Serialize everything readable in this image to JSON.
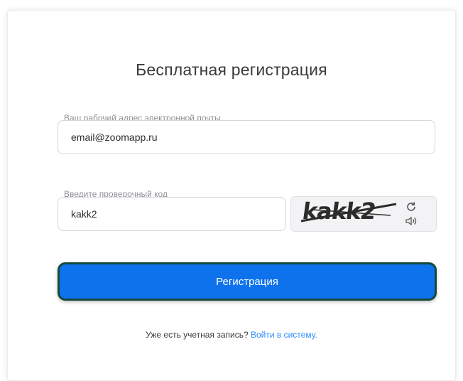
{
  "form": {
    "title": "Бесплатная регистрация",
    "email_label": "Ваш рабочий адрес электронной почты",
    "email_value": "email@zoomapp.ru",
    "code_label": "Введите проверочный код",
    "code_value": "kakk2",
    "captcha_text": "kakk2",
    "submit_label": "Регистрация"
  },
  "footer": {
    "prompt": "Уже есть учетная запись?",
    "login_link": "Войти в систему."
  },
  "icons": {
    "refresh": "refresh-icon",
    "audio": "audio-icon"
  },
  "colors": {
    "primary_button": "#0e72ed",
    "button_border": "#17493a",
    "link": "#2d8cff",
    "title_text": "#3a3a3c",
    "label_text": "#909096"
  }
}
